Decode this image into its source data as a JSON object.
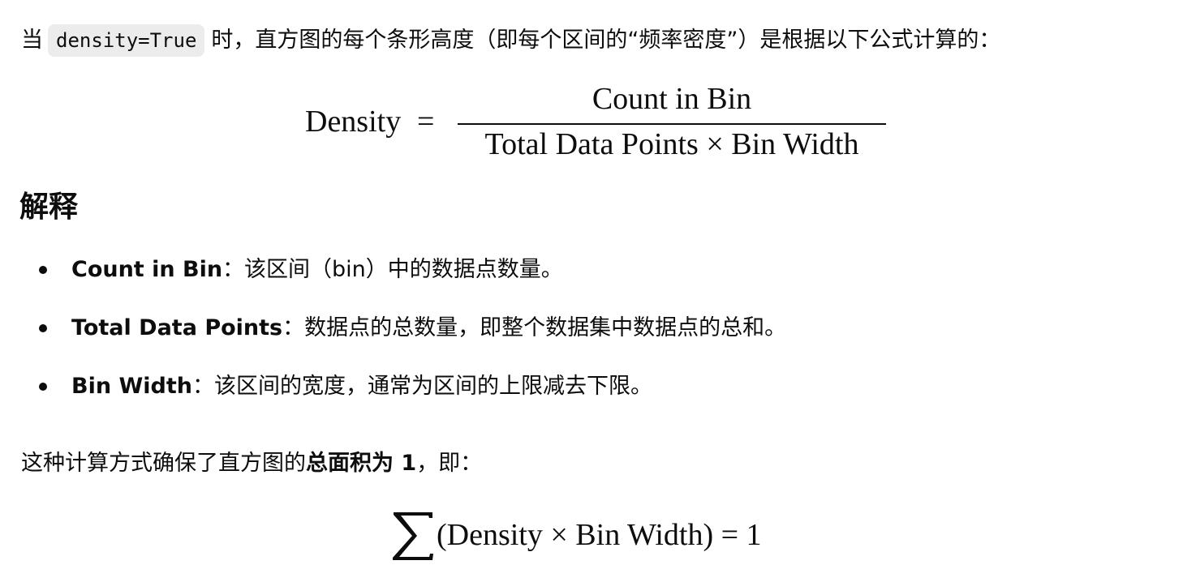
{
  "intro": {
    "prefix": "当",
    "code": "density=True",
    "suffix": "时，直方图的每个条形高度（即每个区间的“频率密度”）是根据以下公式计算的："
  },
  "formula1": {
    "lhs": "Density",
    "eq": "=",
    "numerator": "Count in Bin",
    "denominator": "Total Data Points × Bin Width"
  },
  "heading": "解释",
  "bullets": [
    {
      "term": "Count in Bin",
      "desc": "：该区间（bin）中的数据点数量。"
    },
    {
      "term": "Total Data Points",
      "desc": "：数据点的总数量，即整个数据集中数据点的总和。"
    },
    {
      "term": "Bin Width",
      "desc": "：该区间的宽度，通常为区间的上限减去下限。"
    }
  ],
  "summary": {
    "prefix": "这种计算方式确保了直方图的",
    "bold": "总面积为 1",
    "suffix": "，即："
  },
  "formula2": {
    "expression": "(Density × Bin Width) = 1"
  },
  "colors": {
    "text": "#0d0d0d",
    "code_bg": "#ececec"
  }
}
